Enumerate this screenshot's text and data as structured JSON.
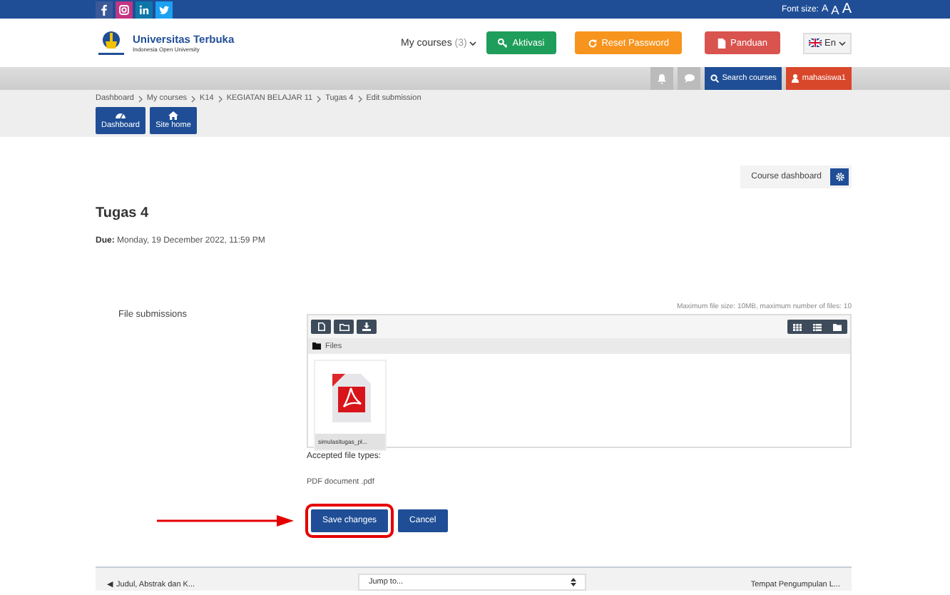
{
  "top_bar": {
    "font_size": {
      "label": "Font size:",
      "options": [
        "A",
        "A",
        "A"
      ]
    }
  },
  "header": {
    "site_name": "Universitas Terbuka",
    "tagline": "Indonesia Open University",
    "my_courses": {
      "label": "My courses",
      "count": "(3)"
    },
    "buttons": [
      {
        "label": "Aktivasi",
        "kind": "key",
        "color": "#1e9e5a"
      },
      {
        "label": "Reset Password",
        "kind": "refresh",
        "color": "#f7941d"
      },
      {
        "label": "Panduan",
        "kind": "document",
        "color": "#d9534f"
      }
    ],
    "language": "En"
  },
  "user_bar": {
    "search_button": "Search courses",
    "user_button": "mahasiswa1"
  },
  "breadcrumb": [
    "Dashboard",
    "My courses",
    "K14",
    "KEGIATAN BELAJAR 11",
    "Tugas 4",
    "Edit submission"
  ],
  "nav_buttons": [
    {
      "label": "Dashboard",
      "kind": "dashboard"
    },
    {
      "label": "Site home",
      "kind": "home"
    }
  ],
  "course_dashboard_button": "Course dashboard",
  "page_title": "Tugas 4",
  "due": {
    "label": "Due:",
    "value": "Monday, 19 December 2022, 11:59 PM"
  },
  "file_submissions": {
    "label": "File submissions",
    "limits": "Maximum file size: 10MB, maximum number of files: 10",
    "path": "Files",
    "files": [
      {
        "name": "simulasitugas_pl..."
      }
    ],
    "accepted_label": "Accepted file types:",
    "accepted_types": "PDF document .pdf"
  },
  "actions": [
    {
      "label": "Save changes",
      "highlighted": true
    },
    {
      "label": "Cancel",
      "highlighted": false
    }
  ],
  "footer": {
    "previous": "◀ Judul, Abstrak dan K...",
    "jump": "Jump to...",
    "next": "Tempat Pengumpulan L..."
  }
}
